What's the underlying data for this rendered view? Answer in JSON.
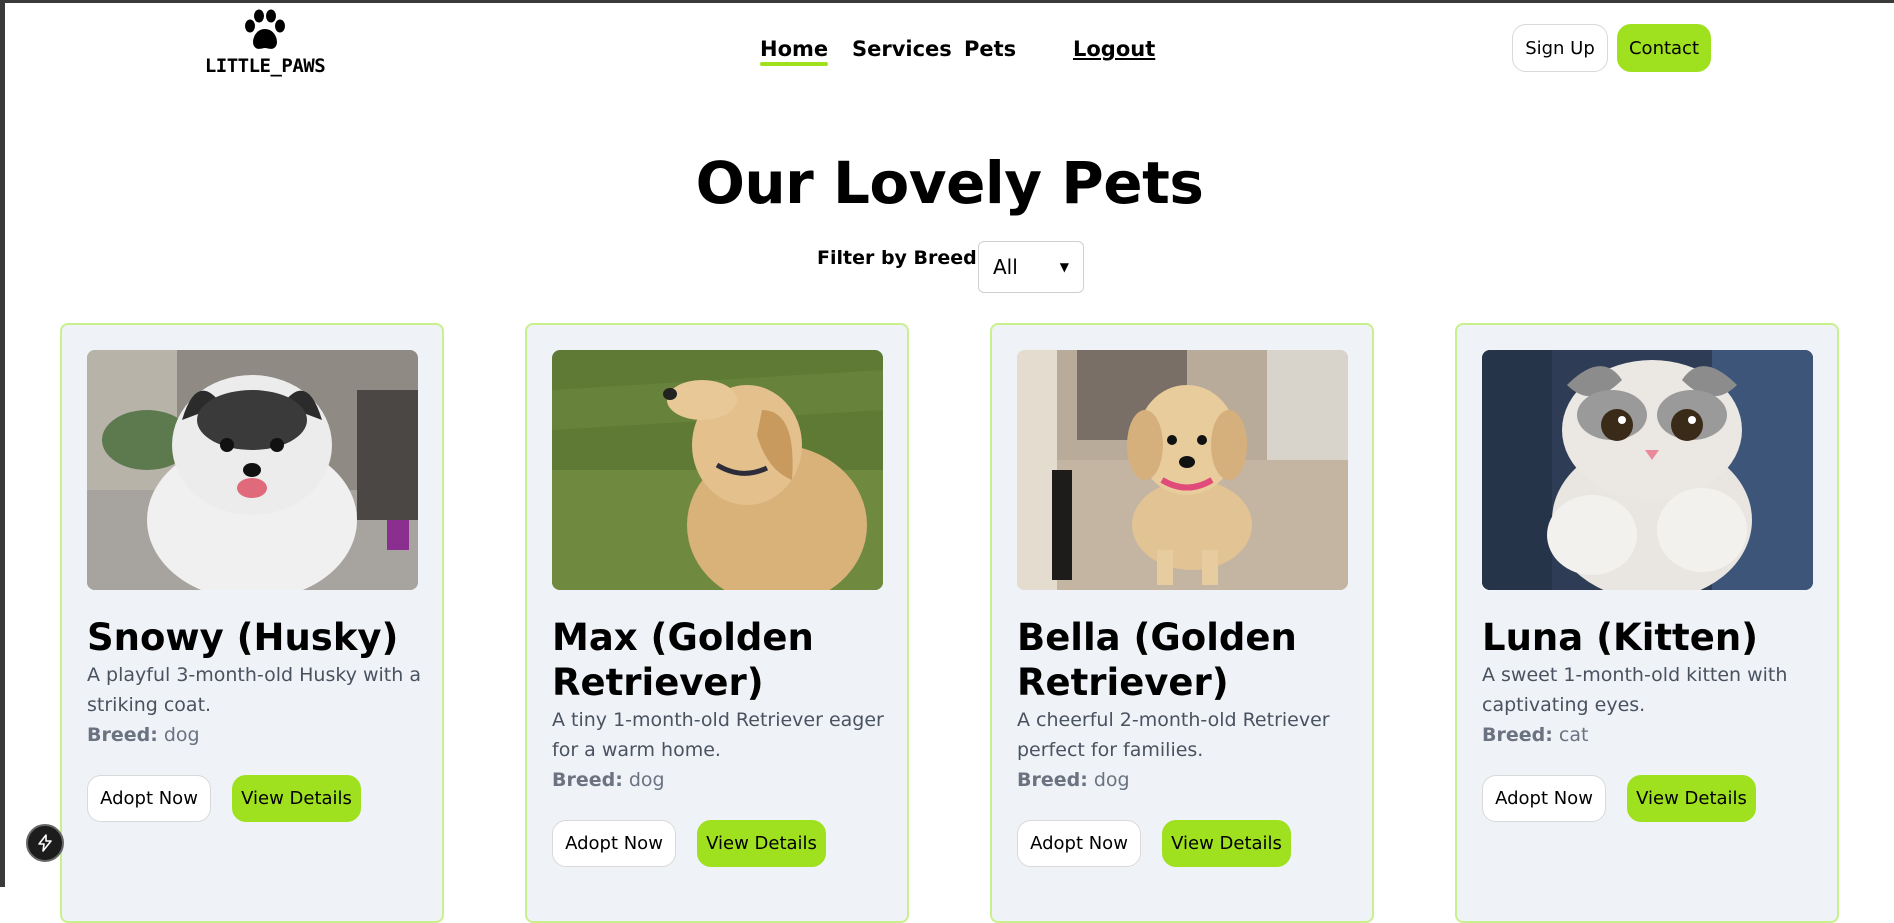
{
  "brand": {
    "name": "LITTLE_PAWS",
    "icon": "paw-icon"
  },
  "nav": {
    "home": "Home",
    "services": "Services",
    "pets": "Pets",
    "logout": "Logout"
  },
  "header_buttons": {
    "signup": "Sign Up",
    "contact": "Contact"
  },
  "page_title": "Our Lovely Pets",
  "filter": {
    "label": "Filter by Breed:",
    "selected": "All"
  },
  "pets": [
    {
      "name": "Snowy (Husky)",
      "description": "A playful 3-month-old Husky with a striking coat.",
      "breed_label": "Breed:",
      "breed": "dog",
      "adopt_label": "Adopt Now",
      "details_label": "View Details"
    },
    {
      "name": "Max (Golden Retriever)",
      "description": "A tiny 1-month-old Retriever eager for a warm home.",
      "breed_label": "Breed:",
      "breed": "dog",
      "adopt_label": "Adopt Now",
      "details_label": "View Details"
    },
    {
      "name": "Bella (Golden Retriever)",
      "description": "A cheerful 2-month-old Retriever perfect for families.",
      "breed_label": "Breed:",
      "breed": "dog",
      "adopt_label": "Adopt Now",
      "details_label": "View Details"
    },
    {
      "name": "Luna (Kitten)",
      "description": "A sweet 1-month-old kitten with captivating eyes.",
      "breed_label": "Breed:",
      "breed": "cat",
      "adopt_label": "Adopt Now",
      "details_label": "View Details"
    }
  ],
  "colors": {
    "accent": "#9fe01f",
    "card_bg": "#eff3f8",
    "card_border": "#c8f08c"
  }
}
